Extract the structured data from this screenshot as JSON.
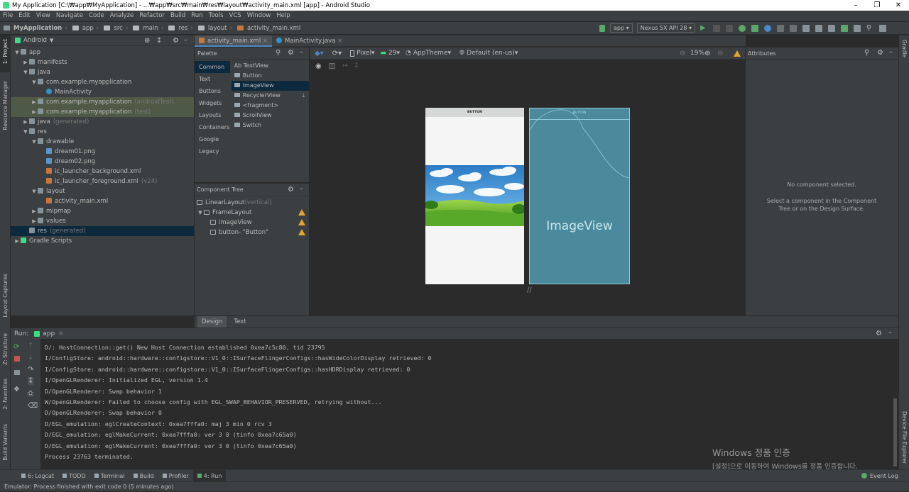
{
  "window": {
    "title": "My Application [C:\\₩app₩MyApplication] - ...₩app₩src₩main₩res₩layout₩activity_main.xml [app] - Android Studio"
  },
  "menu": [
    "File",
    "Edit",
    "View",
    "Navigate",
    "Code",
    "Analyze",
    "Refactor",
    "Build",
    "Run",
    "Tools",
    "VCS",
    "Window",
    "Help"
  ],
  "breadcrumb": [
    "MyApplication",
    "app",
    "src",
    "main",
    "res",
    "layout",
    "activity_main.xml"
  ],
  "toolbar": {
    "config": "app",
    "device": "Nexus 5X API 28"
  },
  "left_strip": {
    "project": "1: Project",
    "resource": "Resource Manager",
    "layout_captures": "Layout Captures",
    "structure": "Z: Structure",
    "favorites": "2: Favorites",
    "build_variants": "Build Variants"
  },
  "right_strip": {
    "gradle": "Gradle",
    "device_file": "Device File Explorer"
  },
  "project": {
    "view": "Android",
    "tree": [
      {
        "label": "app",
        "extra": "",
        "indent": 0,
        "arrow": "▼",
        "icon": "folder",
        "sel": ""
      },
      {
        "label": "manifests",
        "extra": "",
        "indent": 1,
        "arrow": "▶",
        "icon": "folder",
        "sel": ""
      },
      {
        "label": "java",
        "extra": "",
        "indent": 1,
        "arrow": "▼",
        "icon": "folder",
        "sel": ""
      },
      {
        "label": "com.example.myapplication",
        "extra": "",
        "indent": 2,
        "arrow": "▼",
        "icon": "folder",
        "sel": ""
      },
      {
        "label": "MainActivity",
        "extra": "",
        "indent": 3,
        "arrow": "",
        "icon": "class",
        "sel": ""
      },
      {
        "label": "com.example.myapplication",
        "extra": "(androidTest)",
        "indent": 2,
        "arrow": "▶",
        "icon": "folder",
        "sel": "green"
      },
      {
        "label": "com.example.myapplication",
        "extra": "(test)",
        "indent": 2,
        "arrow": "▶",
        "icon": "folder",
        "sel": "green"
      },
      {
        "label": "java",
        "extra": "(generated)",
        "indent": 1,
        "arrow": "▶",
        "icon": "folder",
        "sel": ""
      },
      {
        "label": "res",
        "extra": "",
        "indent": 1,
        "arrow": "▼",
        "icon": "folder",
        "sel": ""
      },
      {
        "label": "drawable",
        "extra": "",
        "indent": 2,
        "arrow": "▼",
        "icon": "folder",
        "sel": ""
      },
      {
        "label": "dream01.png",
        "extra": "",
        "indent": 3,
        "arrow": "",
        "icon": "image",
        "sel": ""
      },
      {
        "label": "dream02.png",
        "extra": "",
        "indent": 3,
        "arrow": "",
        "icon": "image",
        "sel": ""
      },
      {
        "label": "ic_launcher_background.xml",
        "extra": "",
        "indent": 3,
        "arrow": "",
        "icon": "xml",
        "sel": ""
      },
      {
        "label": "ic_launcher_foreground.xml",
        "extra": "(v24)",
        "indent": 3,
        "arrow": "",
        "icon": "xml",
        "sel": ""
      },
      {
        "label": "layout",
        "extra": "",
        "indent": 2,
        "arrow": "▼",
        "icon": "folder",
        "sel": ""
      },
      {
        "label": "activity_main.xml",
        "extra": "",
        "indent": 3,
        "arrow": "",
        "icon": "xml",
        "sel": ""
      },
      {
        "label": "mipmap",
        "extra": "",
        "indent": 2,
        "arrow": "▶",
        "icon": "folder",
        "sel": ""
      },
      {
        "label": "values",
        "extra": "",
        "indent": 2,
        "arrow": "▶",
        "icon": "folder",
        "sel": ""
      },
      {
        "label": "res",
        "extra": "(generated)",
        "indent": 1,
        "arrow": "",
        "icon": "folder",
        "sel": "blue"
      },
      {
        "label": "Gradle Scripts",
        "extra": "",
        "indent": 0,
        "arrow": "▶",
        "icon": "gradle",
        "sel": ""
      }
    ]
  },
  "editor_tabs": [
    "activity_main.xml",
    "MainActivity.java"
  ],
  "palette": {
    "title": "Palette",
    "categories": [
      "Common",
      "Text",
      "Buttons",
      "Widgets",
      "Layouts",
      "Containers",
      "Google",
      "Legacy"
    ],
    "items": [
      "Ab TextView",
      "Button",
      "ImageView",
      "RecyclerView",
      "<fragment>",
      "ScrollView",
      "Switch"
    ]
  },
  "component_tree": {
    "title": "Component Tree",
    "items": [
      {
        "label": "LinearLayout",
        "extra": "(vertical)",
        "warn": false
      },
      {
        "label": "FrameLayout",
        "extra": "",
        "warn": true
      },
      {
        "label": "imageView",
        "extra": "",
        "warn": true
      },
      {
        "label": "button- \"Button\"",
        "extra": "",
        "warn": true
      }
    ]
  },
  "design_toolbar": {
    "device": "Pixel",
    "api": "29",
    "theme": "AppTheme",
    "locale": "Default (en-us)",
    "zoom": "19%"
  },
  "canvas": {
    "button_text": "BUTTON",
    "blueprint_label": "ImageView"
  },
  "attributes": {
    "title": "Attributes",
    "empty": "No component selected.",
    "hint": "Select a component in the Component Tree or on the Design Surface."
  },
  "design_tabs": [
    "Design",
    "Text"
  ],
  "run": {
    "label": "Run:",
    "config": "app",
    "lines": [
      "D/: HostConnection::get() New Host Connection established 0xea7c5c80, tid 23795",
      "I/ConfigStore: android::hardware::configstore::V1_0::ISurfaceFlingerConfigs::hasWideColorDisplay retrieved: 0",
      "I/ConfigStore: android::hardware::configstore::V1_0::ISurfaceFlingerConfigs::hasHDRDisplay retrieved: 0",
      "I/OpenGLRenderer: Initialized EGL, version 1.4",
      "D/OpenGLRenderer: Swap behavior 1",
      "W/OpenGLRenderer: Failed to choose config with EGL_SWAP_BEHAVIOR_PRESERVED, retrying without...",
      "D/OpenGLRenderer: Swap behavior 0",
      "D/EGL_emulation: eglCreateContext: 0xea7fffa0: maj 3 min 0 rcv 3",
      "D/EGL_emulation: eglMakeCurrent: 0xea7fffa0: ver 3 0 (tinfo 0xea7c65a0)",
      "D/EGL_emulation: eglMakeCurrent: 0xea7fffa0: ver 3 0 (tinfo 0xea7c65a0)",
      "Process 23763 terminated."
    ]
  },
  "bottom_tabs": [
    "6: Logcat",
    "TODO",
    "Terminal",
    "Build",
    "Profiler",
    "4: Run"
  ],
  "event_log": "Event Log",
  "status": "Emulator: Process finished with exit code 0 (5 minutes ago)",
  "watermark": {
    "title": "Windows 정품 인증",
    "sub": "[설정]으로 이동하여 Windows를 정품 인증합니다."
  },
  "colors": {
    "accent": "#4a88c7",
    "warning": "#e2a52e",
    "run_green": "#59a869",
    "blueprint": "#4b8a9c"
  }
}
